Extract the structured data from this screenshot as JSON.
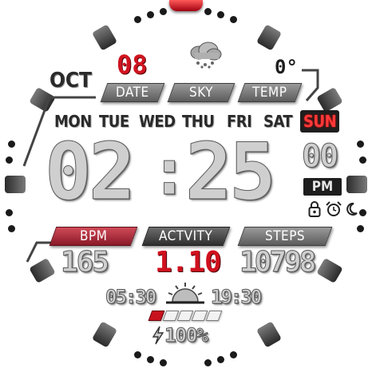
{
  "date": {
    "month": "OCT",
    "day_number": "08",
    "date_label": "DATE"
  },
  "sky": {
    "label": "SKY",
    "icon": "rain-cloud-icon"
  },
  "temp": {
    "value": "0°",
    "label": "TEMP"
  },
  "weekdays": [
    "MON",
    "TUE",
    "WED",
    "THU",
    "FRI",
    "SAT",
    "SUN"
  ],
  "active_weekday": "SUN",
  "time": {
    "hours": "02",
    "separator": ":",
    "minutes": "25",
    "seconds": "00",
    "ampm": "PM"
  },
  "status_icons": [
    "lock-icon",
    "alarm-icon",
    "moon-icon"
  ],
  "stats": {
    "bpm": {
      "label": "BPM",
      "value": "165"
    },
    "activity": {
      "label": "ACTVITY",
      "value": "1.10"
    },
    "steps": {
      "label": "STEPS",
      "value": "10798"
    }
  },
  "sun": {
    "sunrise": "05:30",
    "sunset": "19:30",
    "icon": "sunrise-icon"
  },
  "battery": {
    "percent_text": "100%",
    "icon": "lightning-icon",
    "segments_total": 6,
    "segments_lit": 1
  },
  "colors": {
    "accent_red": "#c8121e",
    "plate_grey": "#7a7a7a",
    "dark": "#1e1e1e"
  }
}
